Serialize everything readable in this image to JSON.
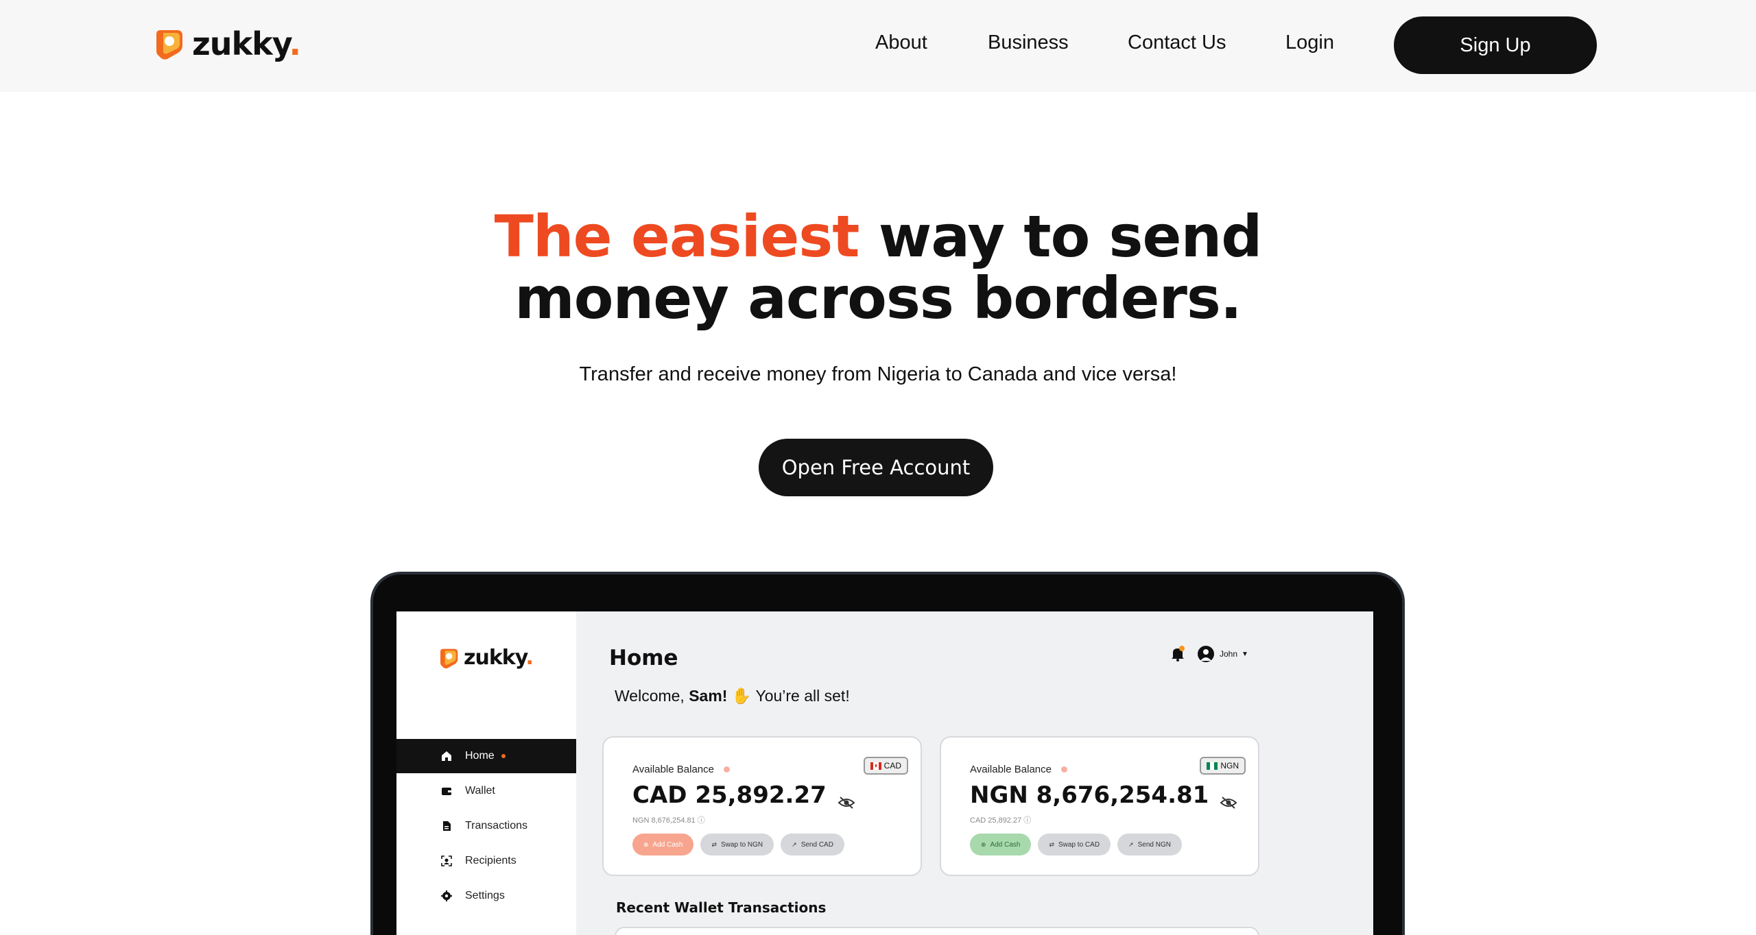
{
  "nav": {
    "brand": "zukky",
    "links": [
      {
        "label": "About"
      },
      {
        "label": "Business"
      },
      {
        "label": "Contact Us"
      },
      {
        "label": "Login"
      }
    ],
    "signup_label": "Sign Up"
  },
  "hero": {
    "title_accent": "The easiest",
    "title_rest_line1": " way to send",
    "title_line2": "money across borders.",
    "subtitle": "Transfer and receive money from Nigeria to Canada and vice versa!",
    "cta_label": "Open Free Account"
  },
  "app": {
    "brand": "zukky",
    "sidebar": [
      {
        "label": "Home",
        "icon": "home-icon"
      },
      {
        "label": "Wallet",
        "icon": "wallet-icon"
      },
      {
        "label": "Transactions",
        "icon": "document-icon"
      },
      {
        "label": "Recipients",
        "icon": "recipients-icon"
      },
      {
        "label": "Settings",
        "icon": "gear-icon"
      }
    ],
    "page_title": "Home",
    "welcome_pre": "Welcome, ",
    "welcome_name": "Sam!",
    "welcome_post": " You’re all set!",
    "user_name": "John",
    "cards": [
      {
        "label": "Available Balance",
        "badge": "CAD",
        "amount": "CAD 25,892.27",
        "sub": "NGN 8,676,254.81",
        "buttons": [
          "Add Cash",
          "Swap to NGN",
          "Send CAD"
        ]
      },
      {
        "label": "Available Balance",
        "badge": "NGN",
        "amount": "NGN 8,676,254.81",
        "sub": "CAD 25,892.27",
        "buttons": [
          "Add Cash",
          "Swap to CAD",
          "Send NGN"
        ]
      }
    ],
    "recent_title": "Recent Wallet Transactions"
  },
  "colors": {
    "accent": "#ee4a21",
    "brand_orange": "#f26b1d",
    "dark": "#111111"
  }
}
